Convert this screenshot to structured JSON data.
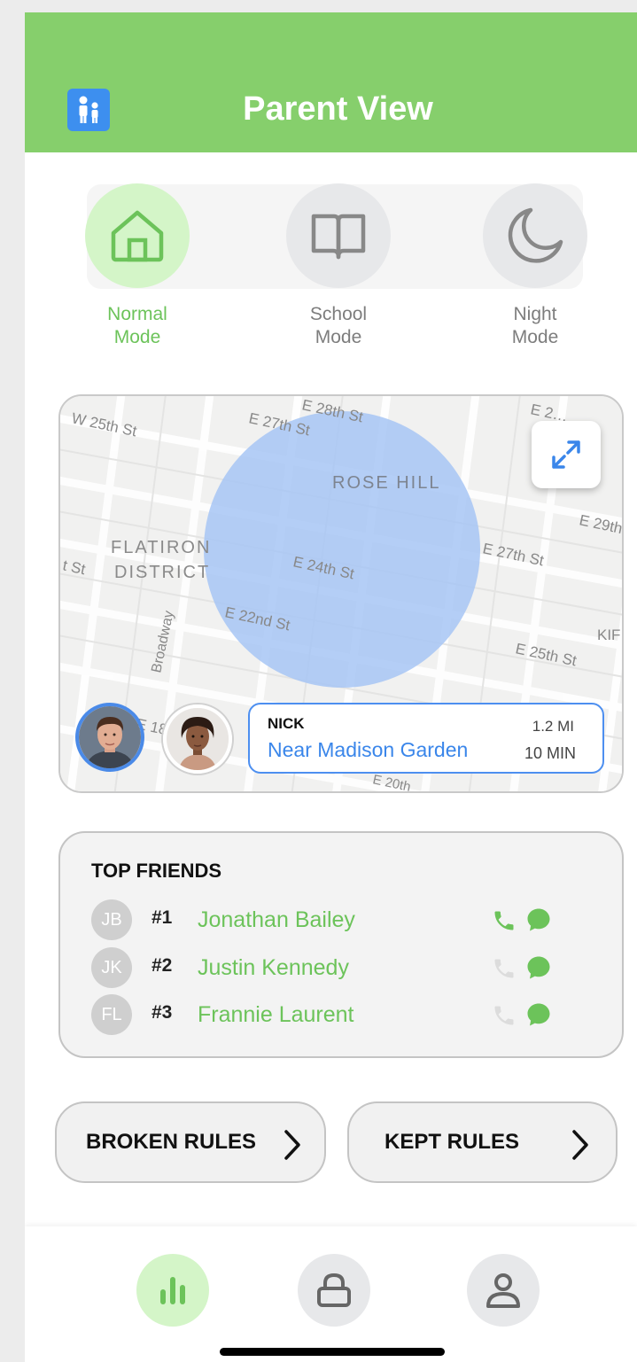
{
  "header": {
    "title": "Parent View",
    "icon": "family-icon",
    "color": "#86cf6c"
  },
  "modes": [
    {
      "label": "Normal\nMode",
      "icon": "home-icon",
      "active": true
    },
    {
      "label": "School\nMode",
      "icon": "book-icon",
      "active": false
    },
    {
      "label": "Night\nMode",
      "icon": "moon-icon",
      "active": false
    }
  ],
  "map": {
    "labels": [
      "W 25th St",
      "E 27th St",
      "E 28th St",
      "E 2…",
      "ROSE HILL",
      "E 29th",
      "FLATIRON",
      "DISTRICT",
      "t St",
      "E 24th St",
      "E 27th St",
      "Broadway",
      "E 22nd St",
      "KIF",
      "E 25th St",
      "E 18",
      "E 20th"
    ],
    "expand_icon": "expand-icon",
    "location": {
      "name": "NICK",
      "place": "Near Madison Garden",
      "distance": "1.2 MI",
      "time": "10 MIN"
    }
  },
  "top_friends": {
    "title": "TOP FRIENDS",
    "items": [
      {
        "initials": "JB",
        "rank": "#1",
        "name": "Jonathan Bailey",
        "call_active": true
      },
      {
        "initials": "JK",
        "rank": "#2",
        "name": "Justin Kennedy",
        "call_active": false
      },
      {
        "initials": "FL",
        "rank": "#3",
        "name": "Frannie Laurent",
        "call_active": false
      }
    ]
  },
  "rules": {
    "broken_label": "BROKEN RULES",
    "kept_label": "KEPT RULES"
  },
  "nav": [
    {
      "icon": "chart-icon",
      "active": true
    },
    {
      "icon": "lock-icon",
      "active": false
    },
    {
      "icon": "profile-icon",
      "active": false
    }
  ],
  "colors": {
    "accent_green": "#6cc35a",
    "map_blue": "#3a86ea",
    "geofence": "#a7c6f5"
  }
}
